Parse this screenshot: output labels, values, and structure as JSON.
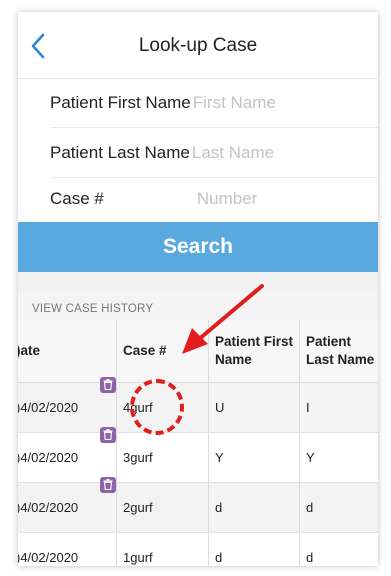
{
  "header": {
    "title": "Look-up Case"
  },
  "form": {
    "first_name": {
      "label": "Patient First Name",
      "placeholder": "First Name"
    },
    "last_name": {
      "label": "Patient Last Name",
      "placeholder": "Last Name"
    },
    "case_number": {
      "label": "Case #",
      "placeholder": "Number"
    }
  },
  "search_button": {
    "label": "Search"
  },
  "history": {
    "section_label": "VIEW CASE HISTORY",
    "columns": {
      "date": ")ate",
      "case": "Case #",
      "first": "Patient First Name",
      "last": "Patient Last Name"
    },
    "rows": [
      {
        "date": ")4/02/2020",
        "case": "4gurf",
        "first": "U",
        "last": "I",
        "has_delete": true
      },
      {
        "date": ")4/02/2020",
        "case": "3gurf",
        "first": "Y",
        "last": "Y",
        "has_delete": true
      },
      {
        "date": ")4/02/2020",
        "case": "2gurf",
        "first": "d",
        "last": "d",
        "has_delete": true
      },
      {
        "date": ")4/02/2020",
        "case": "1gurf",
        "first": "d",
        "last": "d",
        "has_delete": false
      }
    ]
  },
  "icons": {
    "back": "chevron-left-icon",
    "delete": "trash-icon"
  },
  "colors": {
    "accent": "#59a9df",
    "badge": "#8e63a8",
    "annotation": "#e01e1e"
  }
}
